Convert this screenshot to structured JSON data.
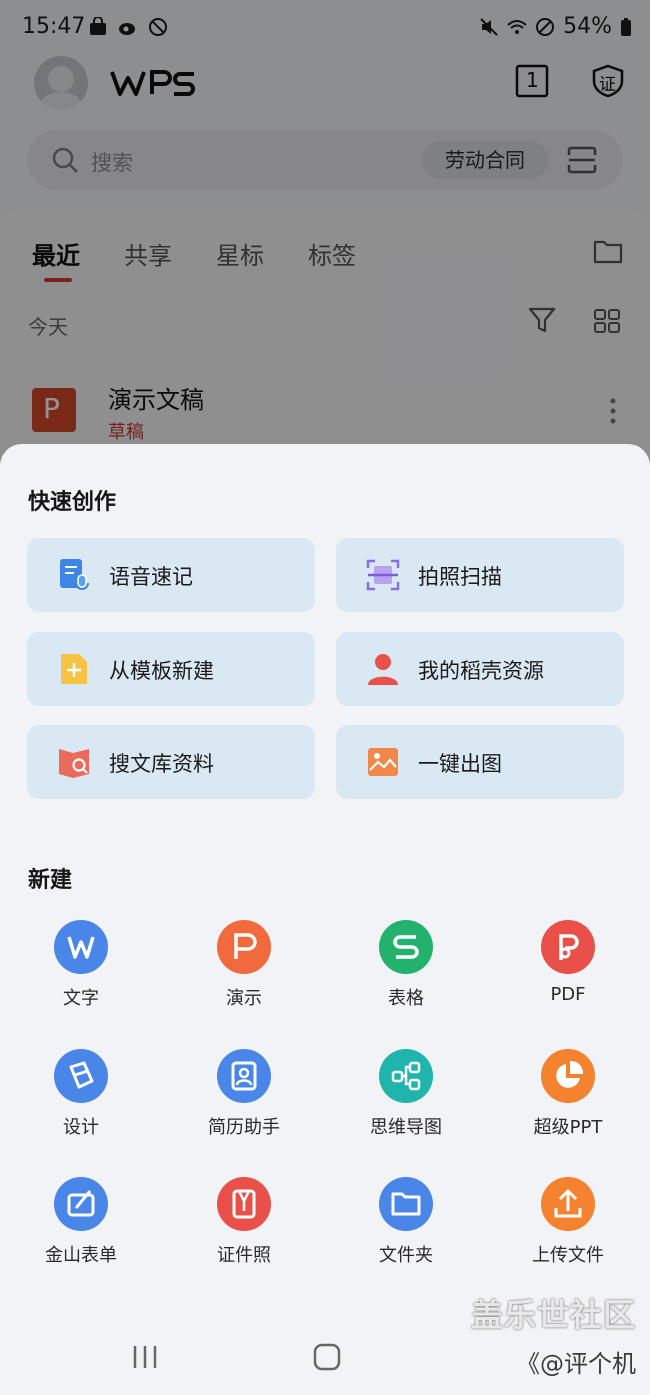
{
  "status_bar": {
    "time": "15:47",
    "battery": "54%"
  },
  "header": {
    "logo": "MPS",
    "tab_count": "1",
    "cert_label": "证"
  },
  "search": {
    "placeholder": "搜索",
    "chip": "劳动合同"
  },
  "tabs": [
    {
      "label": "最近",
      "active": true
    },
    {
      "label": "共享",
      "active": false
    },
    {
      "label": "星标",
      "active": false
    },
    {
      "label": "标签",
      "active": false
    }
  ],
  "recent": {
    "group": "今天",
    "doc": {
      "title": "演示文稿",
      "status": "草稿",
      "thumb_letter": "P"
    }
  },
  "quick_create": {
    "title": "快速创作",
    "items": [
      {
        "label": "语音速记",
        "icon": "voice-note-icon"
      },
      {
        "label": "拍照扫描",
        "icon": "scan-icon"
      },
      {
        "label": "从模板新建",
        "icon": "template-icon"
      },
      {
        "label": "我的稻壳资源",
        "icon": "person-icon"
      },
      {
        "label": "搜文库资料",
        "icon": "library-search-icon"
      },
      {
        "label": "一键出图",
        "icon": "image-generate-icon"
      }
    ]
  },
  "new": {
    "title": "新建",
    "items": [
      {
        "label": "文字",
        "icon": "word-icon",
        "color": "#4a86e8"
      },
      {
        "label": "演示",
        "icon": "presentation-icon",
        "color": "#f06a3d"
      },
      {
        "label": "表格",
        "icon": "spreadsheet-icon",
        "color": "#23b26d"
      },
      {
        "label": "PDF",
        "icon": "pdf-icon",
        "color": "#e9504a"
      },
      {
        "label": "设计",
        "icon": "design-icon",
        "color": "#4a86e8"
      },
      {
        "label": "简历助手",
        "icon": "resume-icon",
        "color": "#4a86e8"
      },
      {
        "label": "思维导图",
        "icon": "mindmap-icon",
        "color": "#1fb5ad"
      },
      {
        "label": "超级PPT",
        "icon": "super-ppt-icon",
        "color": "#f5822e"
      },
      {
        "label": "金山表单",
        "icon": "form-icon",
        "color": "#4a86e8"
      },
      {
        "label": "证件照",
        "icon": "id-photo-icon",
        "color": "#e9504a"
      },
      {
        "label": "文件夹",
        "icon": "folder-icon",
        "color": "#4a86e8"
      },
      {
        "label": "上传文件",
        "icon": "upload-icon",
        "color": "#f5822e"
      }
    ]
  },
  "watermark": {
    "line1": "盖乐世社区",
    "line2": "《@评个机"
  }
}
